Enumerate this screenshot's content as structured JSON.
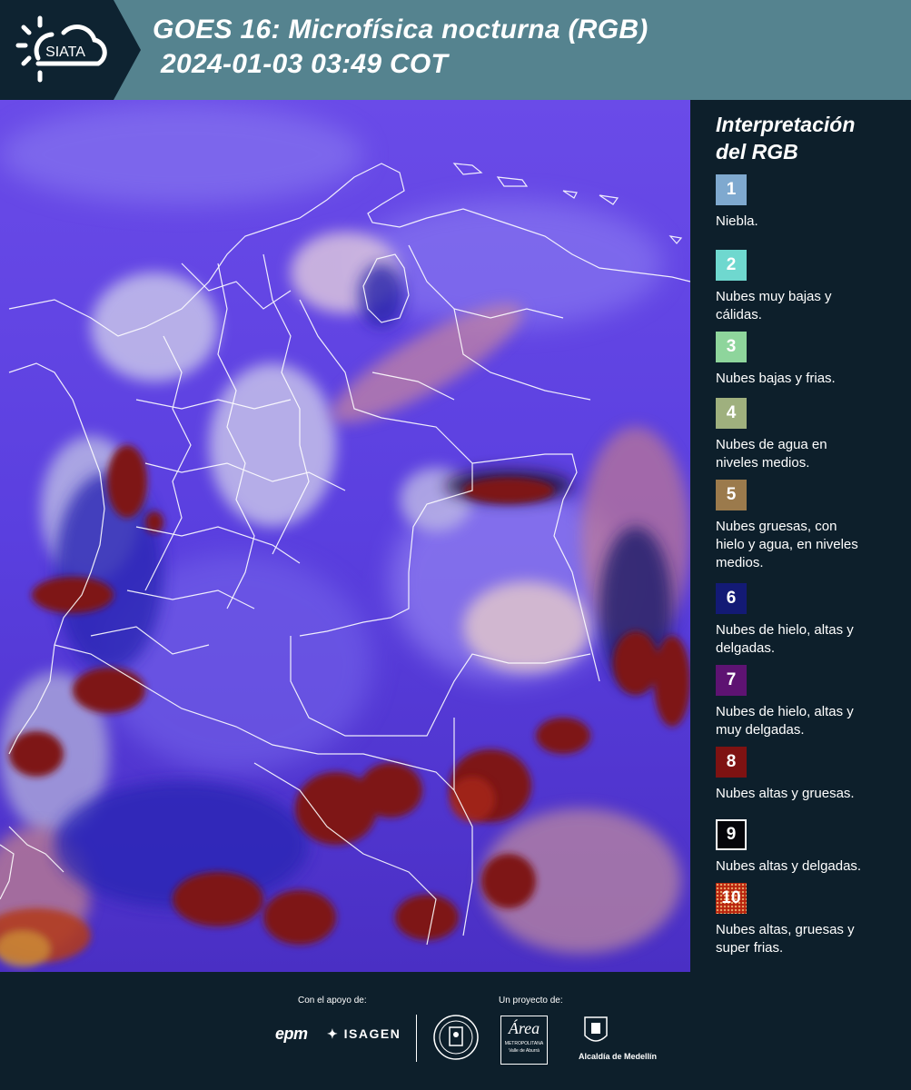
{
  "header": {
    "logo_text": "SIATA",
    "title_line1": "GOES 16: Microfísica nocturna (RGB)",
    "title_line2": "2024-01-03 03:49 COT",
    "background_color": "#55838f"
  },
  "map": {
    "description_icon": "satellite-rgb-image",
    "background_color": "#5a3bdc"
  },
  "legend": {
    "title_line1": "Interpretación",
    "title_line2": "del RGB",
    "items": [
      {
        "number": "1",
        "label_lines": [
          "Niebla."
        ],
        "color": "#7fa9cf"
      },
      {
        "number": "2",
        "label_lines": [
          "Nubes muy bajas y",
          "cálidas."
        ],
        "color": "#6fd8cf"
      },
      {
        "number": "3",
        "label_lines": [
          "Nubes bajas y frias."
        ],
        "color": "#8ed59c"
      },
      {
        "number": "4",
        "label_lines": [
          "Nubes de agua en",
          "niveles medios."
        ],
        "color": "#9fb07e"
      },
      {
        "number": "5",
        "label_lines": [
          "Nubes gruesas, con",
          "hielo y agua, en niveles",
          "medios."
        ],
        "color": "#9b7a4c"
      },
      {
        "number": "6",
        "label_lines": [
          "Nubes de hielo, altas y",
          "delgadas."
        ],
        "color": "#131a75"
      },
      {
        "number": "7",
        "label_lines": [
          "Nubes de hielo, altas y",
          "muy delgadas."
        ],
        "color": "#5e1372"
      },
      {
        "number": "8",
        "label_lines": [
          "Nubes altas y gruesas."
        ],
        "color": "#7e1212"
      },
      {
        "number": "9",
        "label_lines": [
          "Nubes altas y delgadas."
        ],
        "color": "#05050a"
      },
      {
        "number": "10",
        "label_lines": [
          "Nubes altas, gruesas y",
          "super frias."
        ],
        "color": "#b8240e"
      }
    ]
  },
  "footer": {
    "support_label": "Con el apoyo de:",
    "project_label": "Un proyecto de:",
    "sponsors": [
      "epm",
      "ISAGEN"
    ],
    "partners": {
      "area_logo": "Área",
      "area_sub1": "METROPOLITANA",
      "area_sub2": "Valle de Aburrá",
      "medellin": "Alcaldía de Medellín"
    }
  }
}
